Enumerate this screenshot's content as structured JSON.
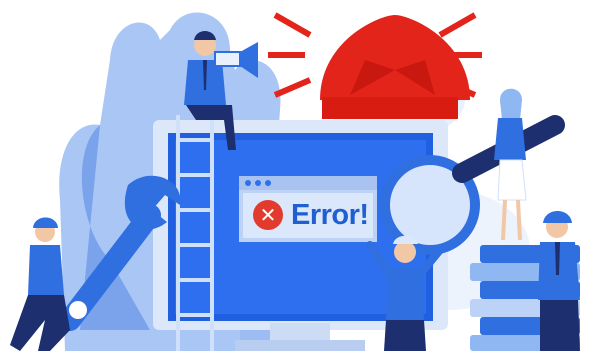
{
  "error_popup": {
    "icon": "close-icon",
    "text": "Error!",
    "icon_color": "#e23b2e",
    "text_color": "#1f5fcf"
  },
  "colors": {
    "primary_blue": "#2f6fe0",
    "light_blue": "#8fb7f2",
    "pale_blue": "#d9e8fb",
    "alarm_red": "#e3241b",
    "suit_dark": "#1d2f6f"
  }
}
